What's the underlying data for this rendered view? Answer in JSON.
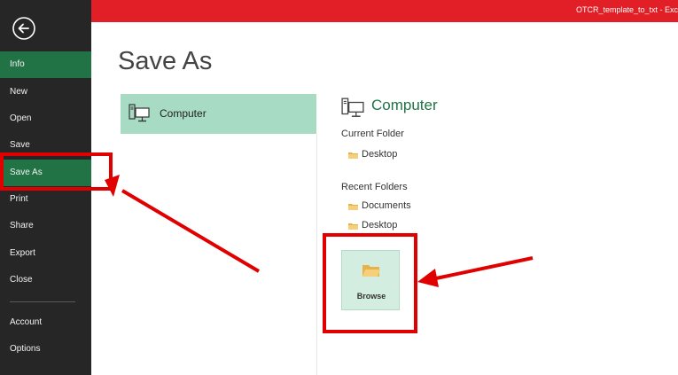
{
  "window": {
    "title": "OTCR_template_to_txt - Exc"
  },
  "sidebar": {
    "items": [
      {
        "label": "Info",
        "active": true
      },
      {
        "label": "New"
      },
      {
        "label": "Open"
      },
      {
        "label": "Save"
      },
      {
        "label": "Save As",
        "highlighted": true
      },
      {
        "label": "Print"
      },
      {
        "label": "Share"
      },
      {
        "label": "Export"
      },
      {
        "label": "Close"
      },
      {
        "label": "Account"
      },
      {
        "label": "Options"
      }
    ]
  },
  "main": {
    "title": "Save As",
    "places": [
      {
        "label": "Computer",
        "icon": "computer-icon",
        "selected": true
      }
    ],
    "panel": {
      "heading": "Computer",
      "current_folder_label": "Current Folder",
      "current_folders": [
        "Desktop"
      ],
      "recent_folders_label": "Recent Folders",
      "recent_folders": [
        "Documents",
        "Desktop"
      ],
      "browse_label": "Browse"
    }
  },
  "colors": {
    "accent": "#217346",
    "titlebar": "#e21f26",
    "sidebar": "#262626",
    "highlight": "#e00000"
  }
}
